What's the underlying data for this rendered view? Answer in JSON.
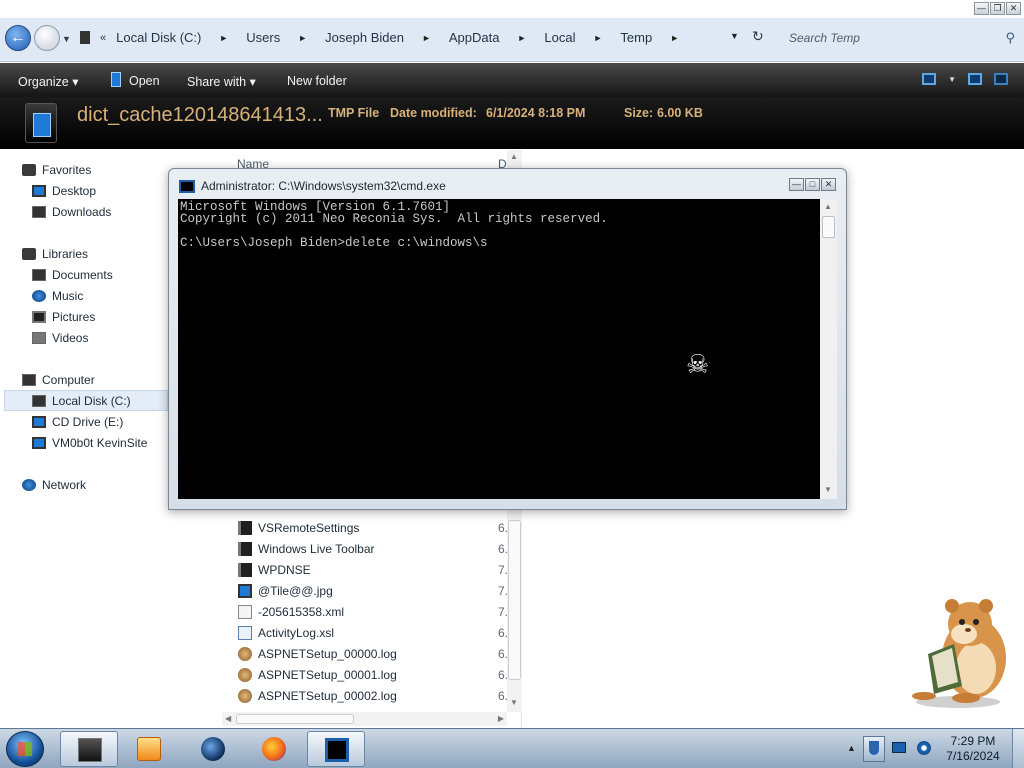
{
  "explorer": {
    "address": {
      "chevron": "«",
      "segments": [
        "Local Disk (C:)",
        "Users",
        "Joseph Biden",
        "AppData",
        "Local",
        "Temp"
      ],
      "search_placeholder": "Search Temp"
    },
    "toolbar": {
      "organize": "Organize",
      "open": "Open",
      "share_with": "Share with",
      "new_folder": "New folder"
    },
    "details": {
      "file_name": "dict_cache120148641413...",
      "file_type": "TMP File",
      "date_modified_label": "Date modified:",
      "date_modified_value": "6/1/2024 8:18 PM",
      "size_label": "Size:",
      "size_value": "6.00 KB"
    },
    "nav": {
      "favorites": "Favorites",
      "desktop": "Desktop",
      "downloads": "Downloads",
      "libraries": "Libraries",
      "documents": "Documents",
      "music": "Music",
      "pictures": "Pictures",
      "videos": "Videos",
      "computer": "Computer",
      "local_disk": "Local Disk (C:)",
      "cd_drive": "CD Drive (E:)",
      "vm_site": "VM0b0t KevinSite",
      "network": "Network"
    },
    "columns": {
      "name": "Name",
      "date": "D"
    },
    "files": [
      {
        "name": "VSRemoteSettings",
        "date": "6."
      },
      {
        "name": "Windows Live Toolbar",
        "date": "6."
      },
      {
        "name": "WPDNSE",
        "date": "7."
      },
      {
        "name": "@Tile@@.jpg",
        "date": "7."
      },
      {
        "name": "-205615358.xml",
        "date": "7."
      },
      {
        "name": "ActivityLog.xsl",
        "date": "6."
      },
      {
        "name": "ASPNETSetup_00000.log",
        "date": "6."
      },
      {
        "name": "ASPNETSetup_00001.log",
        "date": "6."
      },
      {
        "name": "ASPNETSetup_00002.log",
        "date": "6."
      }
    ]
  },
  "cmd": {
    "title": "Administrator: C:\\Windows\\system32\\cmd.exe",
    "lines": [
      "Microsoft Windows [Version 6.1.7601]",
      "Copyright (c) 2011 Neo Reconia Sys.  All rights reserved.",
      "",
      "C:\\Users\\Joseph Biden>delete c:\\windows\\s"
    ]
  },
  "taskbar": {
    "time": "7:29 PM",
    "date": "7/16/2024"
  },
  "colors": {
    "detail_text": "#d8b17a",
    "console_bg": "#000000",
    "console_text": "#c8c8c8",
    "accent": "#1e7ad6"
  }
}
